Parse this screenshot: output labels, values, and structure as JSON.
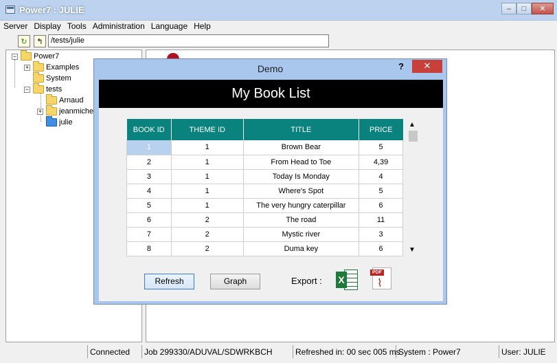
{
  "window": {
    "title": "Power7 : JULIE",
    "min": "–",
    "max": "□",
    "close": "✕"
  },
  "menu": [
    "Server",
    "Display",
    "Tools",
    "Administration",
    "Language",
    "Help"
  ],
  "toolbar": {
    "path": "/tests/julie"
  },
  "tree": {
    "root": "Power7",
    "items": [
      "Examples",
      "System",
      "tests",
      "Arnaud",
      "jeanmiche",
      "julie"
    ]
  },
  "dialog": {
    "title": "Demo",
    "help": "?",
    "close": "✕",
    "header": "My Book List",
    "columns": [
      "BOOK ID",
      "THEME ID",
      "TITLE",
      "PRICE"
    ],
    "rows": [
      [
        "1",
        "1",
        "Brown Bear",
        "5"
      ],
      [
        "2",
        "1",
        "From Head to Toe",
        "4,39"
      ],
      [
        "3",
        "1",
        "Today Is Monday",
        "4"
      ],
      [
        "4",
        "1",
        "Where's Spot",
        "5"
      ],
      [
        "5",
        "1",
        "The very hungry caterpillar",
        "6"
      ],
      [
        "6",
        "2",
        "The road",
        "11"
      ],
      [
        "7",
        "2",
        "Mystic river",
        "3"
      ],
      [
        "8",
        "2",
        "Duma key",
        "6"
      ]
    ],
    "refresh": "Refresh",
    "graph": "Graph",
    "export": "Export :"
  },
  "status": {
    "connected": "Connected",
    "job": "Job 299330/ADUVAL/SDWRKBCH",
    "refreshed": "Refreshed in: 00 sec 005 ms",
    "system": "System : Power7",
    "user": "User: JULIE"
  }
}
